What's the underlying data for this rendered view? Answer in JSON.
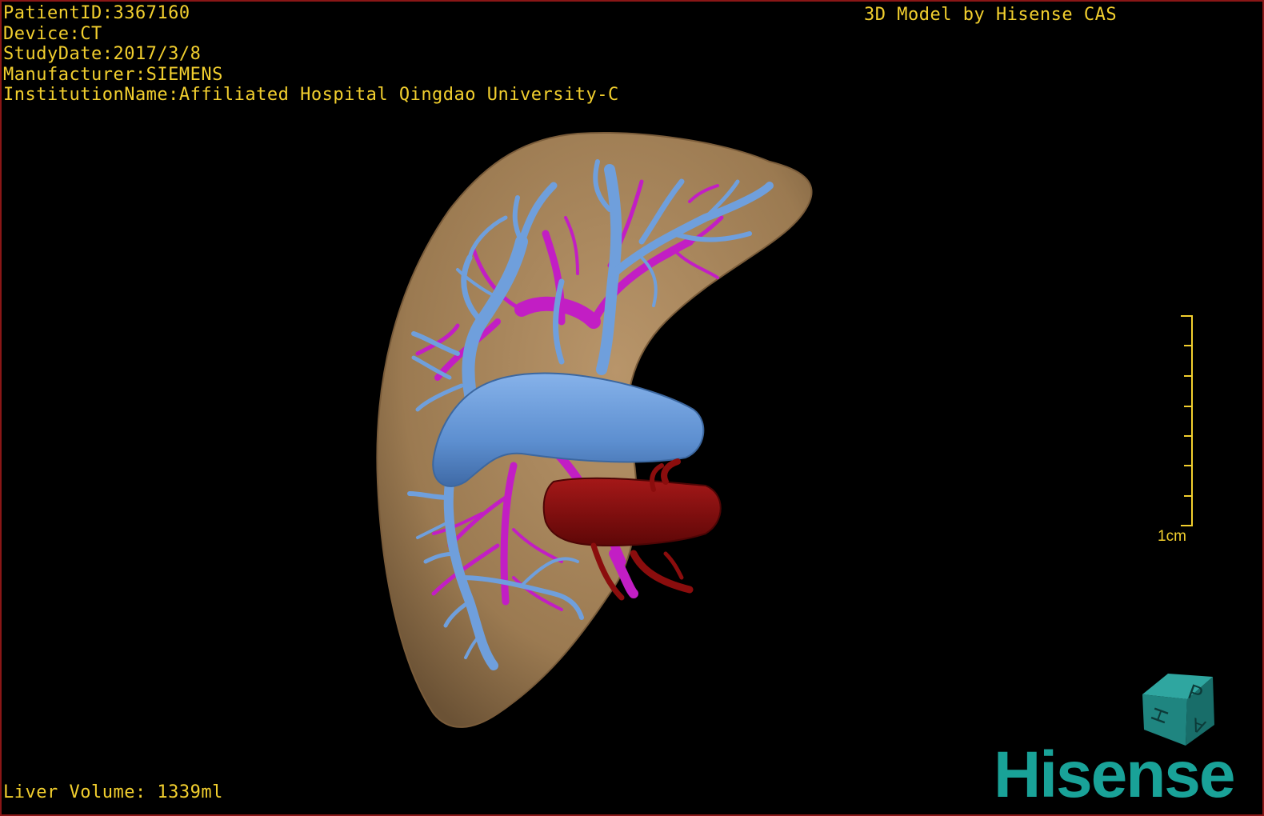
{
  "overlay": {
    "patient_id": "PatientID:3367160",
    "device": "Device:CT",
    "study_date": "StudyDate:2017/3/8",
    "manufacturer": "Manufacturer:SIEMENS",
    "institution": "InstitutionName:Affiliated Hospital Qingdao University-C",
    "credit": "3D Model by Hisense CAS",
    "liver_volume": "Liver Volume: 1339ml"
  },
  "scale": {
    "label": "1cm"
  },
  "orientation_cube": {
    "face_top": "P",
    "face_left": "H",
    "face_right": "A"
  },
  "brand": {
    "logo_text": "Hisense"
  },
  "colors": {
    "overlay_text": "#f2cf2e",
    "liver": "#a8865a",
    "portal_vein": "#6f9fdc",
    "hepatic_vein": "#c21ec4",
    "artery": "#8b0d0d",
    "brand": "#19a298",
    "frame": "#8a1616"
  }
}
